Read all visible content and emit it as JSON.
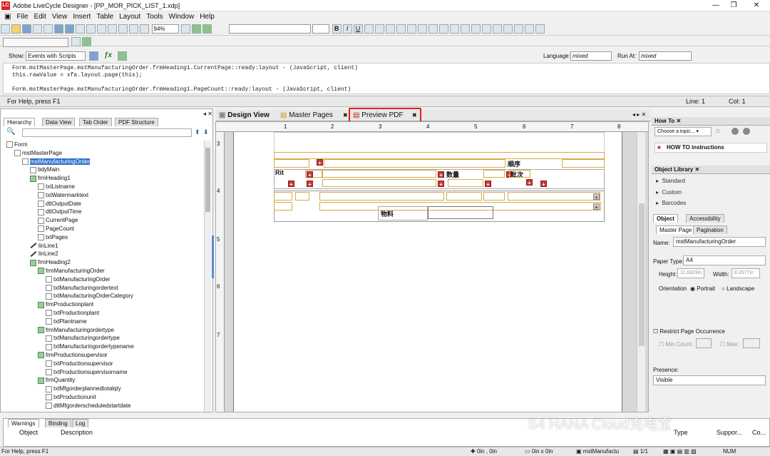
{
  "window": {
    "title": "Adobe LiveCycle Designer - [PP_MOR_PICK_LIST_1.xdp]",
    "app_icon": "LC"
  },
  "menu": [
    "File",
    "Edit",
    "View",
    "Insert",
    "Table",
    "Layout",
    "Tools",
    "Window",
    "Help"
  ],
  "toolbar": {
    "zoom": "94%"
  },
  "script_editor": {
    "show_label": "Show:",
    "show_value": "Events with Scripts",
    "language_label": "Language:",
    "language_value": "mixed",
    "run_at_label": "Run At:",
    "run_at_value": "mixed",
    "lines": [
      "Form.mstMasterPage.mstManufacturingOrder.frmHeading1.CurrentPage::ready:layout - (JavaScript, client)",
      "this.rawValue = xfa.layout.page(this);",
      "",
      "Form.mstMasterPage.mstManufacturingOrder.frmHeading1.PageCount::ready:layout - (JavaScript, client)"
    ]
  },
  "help_status": {
    "text": "For Help, press F1",
    "line": "Line: 1",
    "col": "Col: 1"
  },
  "left_panel": {
    "tabs": [
      "Hierarchy",
      "Data View",
      "Tab Order",
      "PDF Structure"
    ],
    "tree": [
      {
        "label": "Form",
        "depth": 0,
        "icon": "form-icon"
      },
      {
        "label": "mstMasterPage",
        "depth": 1,
        "icon": "page-icon"
      },
      {
        "label": "mstManufacturingOrder",
        "depth": 2,
        "icon": "page-icon",
        "selected": true
      },
      {
        "label": "bdyMain",
        "depth": 3,
        "icon": "page-icon"
      },
      {
        "label": "frmHeading1",
        "depth": 3,
        "icon": "subform-icon"
      },
      {
        "label": "txtListname",
        "depth": 4,
        "icon": "field-icon"
      },
      {
        "label": "txtWatermarktext",
        "depth": 4,
        "icon": "field-icon"
      },
      {
        "label": "dttOutputDate",
        "depth": 4,
        "icon": "date-icon"
      },
      {
        "label": "dttOutputTime",
        "depth": 4,
        "icon": "date-icon"
      },
      {
        "label": "CurrentPage",
        "depth": 4,
        "icon": "field-icon"
      },
      {
        "label": "PageCount",
        "depth": 4,
        "icon": "field-icon"
      },
      {
        "label": "txtPages",
        "depth": 4,
        "icon": "text-icon"
      },
      {
        "label": "linLine1",
        "depth": 3,
        "icon": "line-icon"
      },
      {
        "label": "linLine2",
        "depth": 3,
        "icon": "line-icon"
      },
      {
        "label": "frmHeading2",
        "depth": 3,
        "icon": "subform-icon"
      },
      {
        "label": "frmManufacturingOrder",
        "depth": 4,
        "icon": "subform-icon"
      },
      {
        "label": "txtManufacturingOrder",
        "depth": 5,
        "icon": "field-icon"
      },
      {
        "label": "txtManufacturingordertext",
        "depth": 5,
        "icon": "field-icon"
      },
      {
        "label": "txtManufacturingOrderCategory",
        "depth": 5,
        "icon": "field-icon"
      },
      {
        "label": "frmProductionplant",
        "depth": 4,
        "icon": "subform-icon"
      },
      {
        "label": "txtProductionplant",
        "depth": 5,
        "icon": "field-icon"
      },
      {
        "label": "txtPlantname",
        "depth": 5,
        "icon": "field-icon"
      },
      {
        "label": "frmManufacturingordertype",
        "depth": 4,
        "icon": "subform-icon"
      },
      {
        "label": "txtManufacturingordertype",
        "depth": 5,
        "icon": "field-icon"
      },
      {
        "label": "txtManufacturingordertypename",
        "depth": 5,
        "icon": "field-icon"
      },
      {
        "label": "frmProductionsupervisor",
        "depth": 4,
        "icon": "subform-icon"
      },
      {
        "label": "txtProductionsupervisor",
        "depth": 5,
        "icon": "field-icon"
      },
      {
        "label": "txtProductionsupervisorname",
        "depth": 5,
        "icon": "field-icon"
      },
      {
        "label": "frmQuantity",
        "depth": 4,
        "icon": "subform-icon"
      },
      {
        "label": "txtMfgorderplannedtotalqty",
        "depth": 5,
        "icon": "field-icon"
      },
      {
        "label": "txtProductionunit",
        "depth": 5,
        "icon": "field-icon"
      },
      {
        "label": "dttMfgorderscheduledstartdate",
        "depth": 5,
        "icon": "date-icon"
      }
    ]
  },
  "editor": {
    "tabs": [
      "Design View",
      "Master Pages",
      "Preview PDF"
    ],
    "ruler": [
      "1",
      "2",
      "3",
      "4",
      "5",
      "6",
      "7",
      "8"
    ],
    "vruler": [
      "3",
      "4",
      "5",
      "6",
      "7"
    ],
    "form_labels": {
      "seq": "順序",
      "rit": "Rit",
      "qty": "数量",
      "batch": "批次",
      "material": "物料"
    }
  },
  "right_panel": {
    "howto_title": "How To",
    "howto_select": "Choose a topic...",
    "howto_link": "HOW TO instructions",
    "library_title": "Object Library",
    "library_items": [
      "Standard",
      "Custom",
      "Barcodes"
    ],
    "object_tabs": [
      "Object",
      "Accessibility"
    ],
    "sub_tabs": [
      "Master Page",
      "Pagination"
    ],
    "name_label": "Name:",
    "name_value": "mstManufacturingOrder",
    "paper_label": "Paper Type:",
    "paper_value": "A4",
    "height_label": "Height:",
    "height_value": "11.6929in",
    "width_label": "Width:",
    "width_value": "8.2677in",
    "orientation_label": "Orientation",
    "portrait": "Portrait",
    "landscape": "Landscape",
    "restrict_label": "Restrict Page Occurrence",
    "min_label": "Min Count:",
    "max_label": "Max:",
    "presence_label": "Presence:",
    "presence_value": "Visible"
  },
  "bottom_panel": {
    "tabs": [
      "Warnings",
      "Binding",
      "Log"
    ],
    "columns": [
      "Object",
      "Description",
      "Type",
      "Suppor...",
      "Co..."
    ]
  },
  "statusbar": {
    "help": "For Help, press F1",
    "pos": "0in , 0in",
    "size": "0in x 0in",
    "object": "mstManufactu",
    "page": "1/1",
    "mode": "NUM"
  },
  "watermark": "S4 HANA Cloud充电宝"
}
